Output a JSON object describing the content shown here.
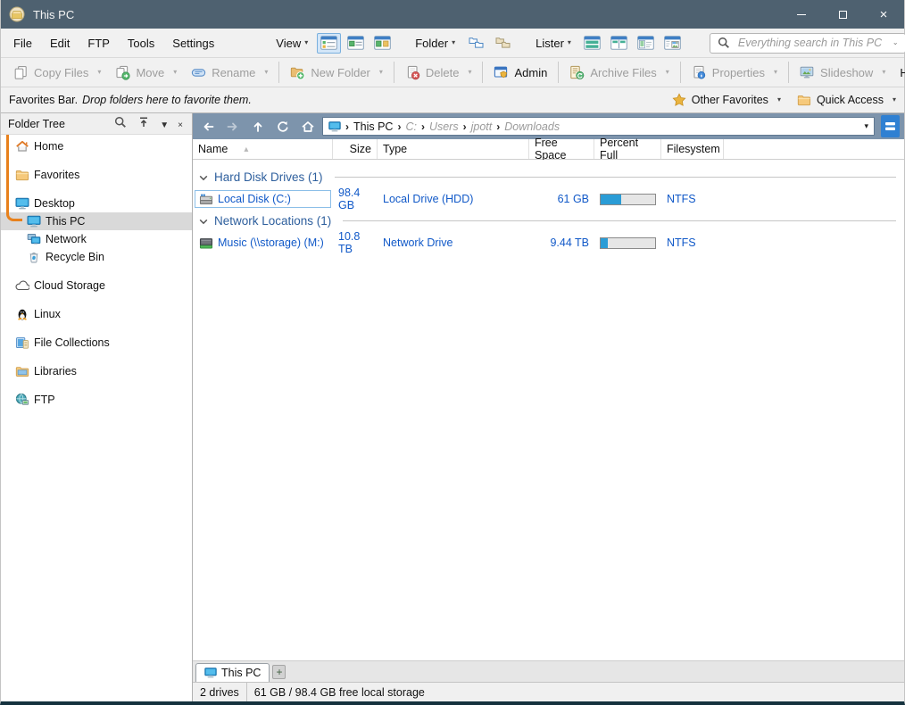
{
  "window": {
    "title": "This PC"
  },
  "menu_bar": {
    "items": [
      "File",
      "Edit",
      "FTP",
      "Tools",
      "Settings"
    ]
  },
  "view_section": {
    "label": "View",
    "buttons": [
      {
        "icon": "view-details",
        "selected": true
      },
      {
        "icon": "view-power",
        "selected": false
      },
      {
        "icon": "view-thumbnails",
        "selected": false
      }
    ]
  },
  "folder_section": {
    "label": "Folder",
    "buttons": [
      {
        "icon": "folder-pair",
        "selected": false
      },
      {
        "icon": "folder-pair-alt",
        "selected": false
      }
    ]
  },
  "lister_section": {
    "label": "Lister",
    "buttons": [
      {
        "icon": "lister-horizontal",
        "selected": false
      },
      {
        "icon": "lister-vertical",
        "selected": false
      },
      {
        "icon": "lister-tree",
        "selected": false
      },
      {
        "icon": "lister-image",
        "selected": false
      }
    ]
  },
  "search": {
    "placeholder": "Everything search in This PC"
  },
  "toolbar": {
    "buttons": [
      {
        "label": "Copy Files",
        "icon": "copy-files",
        "enabled": false,
        "dropdown": true
      },
      {
        "label": "Move",
        "icon": "move",
        "enabled": false,
        "dropdown": true
      },
      {
        "label": "Rename",
        "icon": "rename",
        "enabled": false,
        "dropdown": true,
        "separator_after": true
      },
      {
        "label": "New Folder",
        "icon": "new-folder",
        "enabled": false,
        "dropdown": true,
        "separator_after": true
      },
      {
        "label": "Delete",
        "icon": "delete",
        "enabled": false,
        "dropdown": true,
        "separator_after": true
      },
      {
        "label": "Admin",
        "icon": "admin",
        "enabled": true,
        "dropdown": false,
        "separator_after": true
      },
      {
        "label": "Archive Files",
        "icon": "archive-files",
        "enabled": false,
        "dropdown": true,
        "separator_after": true
      },
      {
        "label": "Properties",
        "icon": "properties",
        "enabled": false,
        "dropdown": true,
        "separator_after": true
      },
      {
        "label": "Slideshow",
        "icon": "slideshow",
        "enabled": false,
        "dropdown": true
      }
    ],
    "help": {
      "label": "Help",
      "icon": "help",
      "dropdown": true
    }
  },
  "favorites_bar": {
    "title": "Favorites Bar.",
    "hint": "Drop folders here to favorite them.",
    "items": [
      {
        "label": "Other Favorites",
        "icon": "star",
        "dropdown": true
      },
      {
        "label": "Quick Access",
        "icon": "folder",
        "dropdown": true
      }
    ]
  },
  "folder_tree": {
    "title": "Folder Tree",
    "tools": [
      {
        "name": "tree-search",
        "icon": "search"
      },
      {
        "name": "tree-collapse",
        "icon": "collapse"
      },
      {
        "name": "tree-menu",
        "glyph": "▼"
      },
      {
        "name": "tree-close",
        "glyph": "×"
      }
    ],
    "items": [
      {
        "label": "Home",
        "icon": "home",
        "indent": 0,
        "spaced": false,
        "selected": false
      },
      {
        "label": "Favorites",
        "icon": "folder",
        "indent": 0,
        "spaced": true,
        "selected": false
      },
      {
        "label": "Desktop",
        "icon": "desktop",
        "indent": 0,
        "spaced": true,
        "selected": false
      },
      {
        "label": "This PC",
        "icon": "computer",
        "indent": 1,
        "spaced": false,
        "selected": true
      },
      {
        "label": "Network",
        "icon": "network",
        "indent": 1,
        "spaced": false,
        "selected": false
      },
      {
        "label": "Recycle Bin",
        "icon": "recycle-bin",
        "indent": 1,
        "spaced": false,
        "selected": false
      },
      {
        "label": "Cloud Storage",
        "icon": "cloud",
        "indent": 0,
        "spaced": true,
        "selected": false
      },
      {
        "label": "Linux",
        "icon": "linux",
        "indent": 0,
        "spaced": true,
        "selected": false
      },
      {
        "label": "File Collections",
        "icon": "file-collections",
        "indent": 0,
        "spaced": true,
        "selected": false
      },
      {
        "label": "Libraries",
        "icon": "libraries",
        "indent": 0,
        "spaced": true,
        "selected": false
      },
      {
        "label": "FTP",
        "icon": "ftp",
        "indent": 0,
        "spaced": true,
        "selected": false
      }
    ]
  },
  "navigation": {
    "buttons": [
      {
        "name": "back-button",
        "icon": "back",
        "enabled": true
      },
      {
        "name": "forward-button",
        "icon": "forward",
        "enabled": false
      },
      {
        "name": "up-button",
        "icon": "up",
        "enabled": true
      },
      {
        "name": "refresh-button",
        "icon": "refresh",
        "enabled": true
      },
      {
        "name": "home-button",
        "icon": "home-nav",
        "enabled": true
      }
    ],
    "breadcrumb": {
      "icon": "computer",
      "root": "This PC",
      "segments": [
        "C:",
        "Users",
        "jpott",
        "Downloads"
      ]
    },
    "dual_display_button": {
      "icon": "dual-display"
    }
  },
  "file_list": {
    "columns": [
      {
        "label": "Name",
        "align": "left",
        "sort": "asc"
      },
      {
        "label": "Size",
        "align": "right"
      },
      {
        "label": "Type",
        "align": "left"
      },
      {
        "label": "Free Space",
        "align": "right"
      },
      {
        "label": "Percent Full",
        "align": "left"
      },
      {
        "label": "Filesystem",
        "align": "left"
      }
    ],
    "groups": [
      {
        "label": "Hard Disk Drives (1)",
        "rows": [
          {
            "icon": "hard-disk",
            "name": "Local Disk (C:)",
            "size": "98.4 GB",
            "type": "Local Drive (HDD)",
            "free_space": "61 GB",
            "percent_full": 38,
            "filesystem": "NTFS",
            "selected": true
          }
        ]
      },
      {
        "label": "Network Locations (1)",
        "rows": [
          {
            "icon": "network-drive",
            "name": "Music (\\\\storage) (M:)",
            "size": "10.8 TB",
            "type": "Network Drive",
            "free_space": "9.44 TB",
            "percent_full": 13,
            "filesystem": "NTFS",
            "selected": false
          }
        ]
      }
    ]
  },
  "tab_bar": {
    "tabs": [
      {
        "label": "This PC",
        "icon": "computer",
        "active": true
      }
    ],
    "new_tab_label": "+"
  },
  "status_bar": {
    "sections": [
      "2 drives",
      "61 GB / 98.4 GB free local storage"
    ]
  },
  "colors": {
    "titlebar": "#4e6170",
    "navbar": "#7d94ac",
    "row_text": "#1159c8",
    "group_text": "#2e5f9d",
    "path_highlight": "#e8811c",
    "percent_bar_fill": "#2a9cd6"
  }
}
